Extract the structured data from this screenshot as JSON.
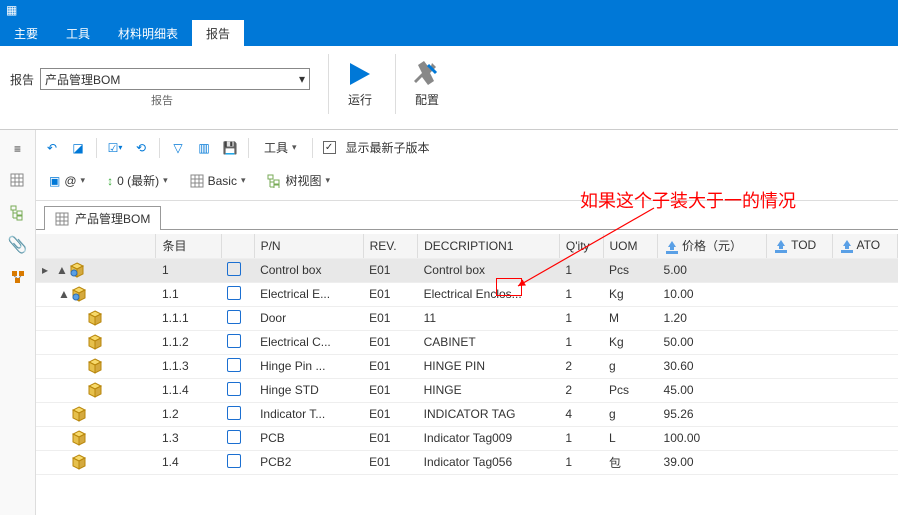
{
  "window": {
    "icon": "list-icon"
  },
  "menu": {
    "main": "主要",
    "tools": "工具",
    "bom": "材料明细表",
    "report": "报告",
    "active": "报告"
  },
  "ribbon": {
    "report_label": "报告",
    "report_select_value": "产品管理BOM",
    "run": "运行",
    "config": "配置",
    "group_label": "报告"
  },
  "toolbar": {
    "tools_label": "工具",
    "show_latest_label": "显示最新子版本"
  },
  "toolbar2": {
    "at_label": "@",
    "revision_label": "0 (最新)",
    "basic_label": "Basic",
    "tree_label": "树视图"
  },
  "doc_tab": {
    "label": "产品管理BOM"
  },
  "columns": {
    "item": "条目",
    "pn": "P/N",
    "rev": "REV.",
    "desc": "DECCRIPTION1",
    "qty": "Q'ity",
    "uom": "UOM",
    "price": "价格（元）",
    "tod": "TOD",
    "ato": "ATO"
  },
  "rows": [
    {
      "lvl": 0,
      "exp": "▲",
      "icon": "asm",
      "item": "1",
      "pn": "Control box",
      "rev": "E01",
      "desc": "Control box",
      "qty": "1",
      "uom": "Pcs",
      "price": "5.00",
      "sel": true
    },
    {
      "lvl": 1,
      "exp": "▲",
      "icon": "asm",
      "item": "1.1",
      "pn": "Electrical E...",
      "rev": "E01",
      "desc": "Electrical Enclos...",
      "qty": "1",
      "uom": "Kg",
      "price": "10.00"
    },
    {
      "lvl": 2,
      "exp": "",
      "icon": "part",
      "item": "1.1.1",
      "pn": "Door",
      "rev": "E01",
      "desc": "11",
      "qty": "1",
      "uom": "M",
      "price": "1.20"
    },
    {
      "lvl": 2,
      "exp": "",
      "icon": "part",
      "item": "1.1.2",
      "pn": "Electrical C...",
      "rev": "E01",
      "desc": "CABINET",
      "qty": "1",
      "uom": "Kg",
      "price": "50.00"
    },
    {
      "lvl": 2,
      "exp": "",
      "icon": "part",
      "item": "1.1.3",
      "pn": "Hinge Pin ...",
      "rev": "E01",
      "desc": "HINGE PIN",
      "qty": "2",
      "uom": "g",
      "price": "30.60"
    },
    {
      "lvl": 2,
      "exp": "",
      "icon": "part",
      "item": "1.1.4",
      "pn": "Hinge STD",
      "rev": "E01",
      "desc": "HINGE",
      "qty": "2",
      "uom": "Pcs",
      "price": "45.00"
    },
    {
      "lvl": 1,
      "exp": "",
      "icon": "part",
      "item": "1.2",
      "pn": "Indicator T...",
      "rev": "E01",
      "desc": "INDICATOR TAG",
      "qty": "4",
      "uom": "g",
      "price": "95.26"
    },
    {
      "lvl": 1,
      "exp": "",
      "icon": "part",
      "item": "1.3",
      "pn": "PCB",
      "rev": "E01",
      "desc": "Indicator Tag009",
      "qty": "1",
      "uom": "L",
      "price": "100.00"
    },
    {
      "lvl": 1,
      "exp": "",
      "icon": "part",
      "item": "1.4",
      "pn": "PCB2",
      "rev": "E01",
      "desc": "Indicator Tag056",
      "qty": "1",
      "uom": "包",
      "price": "39.00"
    }
  ],
  "annotation": "如果这个子装大于一的情况"
}
